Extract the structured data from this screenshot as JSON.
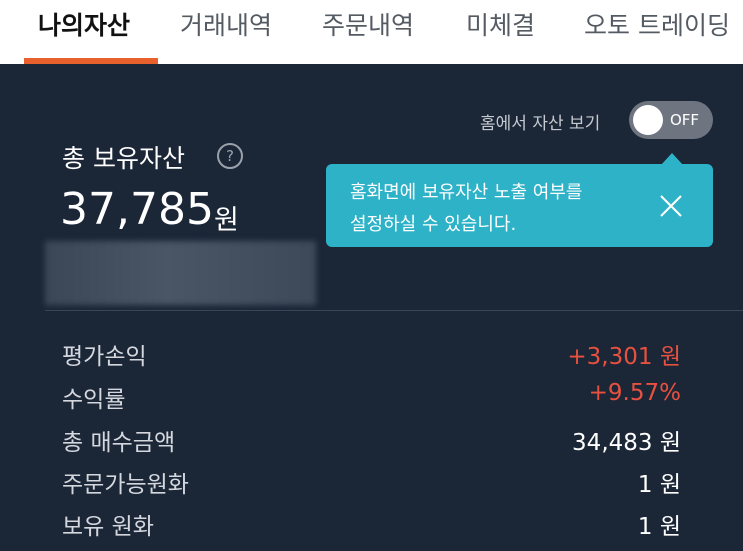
{
  "tabs": [
    {
      "label": "나의자산",
      "active": true
    },
    {
      "label": "거래내역",
      "active": false
    },
    {
      "label": "주문내역",
      "active": false
    },
    {
      "label": "미체결",
      "active": false
    },
    {
      "label": "오토 트레이딩",
      "active": false
    }
  ],
  "home_toggle": {
    "label": "홈에서 자산 보기",
    "state": "OFF"
  },
  "tooltip": {
    "line1": "홈화면에 보유자산 노출 여부를",
    "line2": "설정하실 수 있습니다."
  },
  "total": {
    "title": "총 보유자산",
    "help_symbol": "?",
    "amount": "37,785",
    "unit": "원"
  },
  "rows": [
    {
      "label": "평가손익",
      "value": "+3,301 원"
    },
    {
      "label": "수익률",
      "value": "+9.57%"
    },
    {
      "label": "총 매수금액",
      "value": "34,483 원"
    },
    {
      "label": "주문가능원화",
      "value": "1 원"
    },
    {
      "label": "보유 원화",
      "value": "1 원"
    }
  ],
  "colors": {
    "background": "#1b2637",
    "accent": "#e8612c",
    "tooltip": "#2eb2c7",
    "profit": "#e8513f"
  }
}
